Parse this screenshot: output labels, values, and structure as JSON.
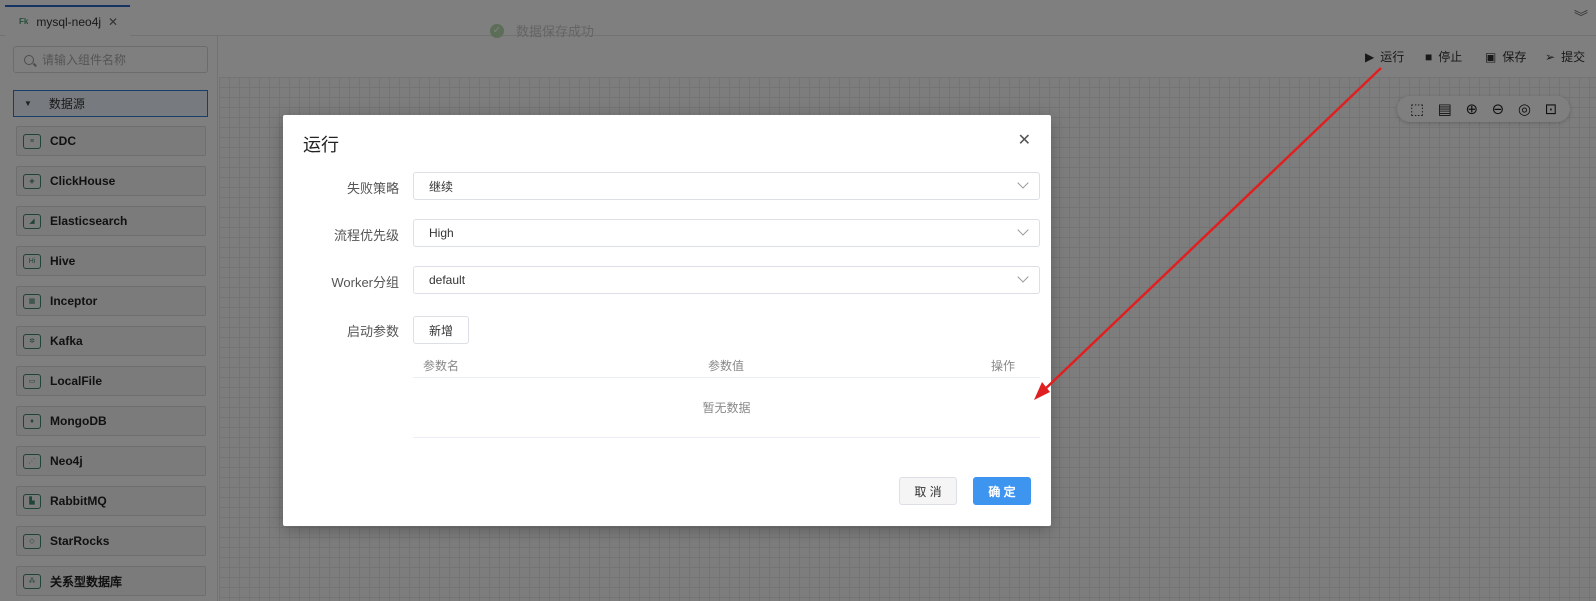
{
  "tab": {
    "title": "mysql-neo4j",
    "icon_label": "Fk"
  },
  "toast": {
    "message": "数据保存成功"
  },
  "sidebar": {
    "search_placeholder": "请输入组件名称",
    "group_label": "数据源",
    "items": [
      {
        "label": "CDC",
        "icon": "cdc-icon"
      },
      {
        "label": "ClickHouse",
        "icon": "clickhouse-icon"
      },
      {
        "label": "Elasticsearch",
        "icon": "elasticsearch-icon"
      },
      {
        "label": "Hive",
        "icon": "hive-icon",
        "glyph": "Hi"
      },
      {
        "label": "Inceptor",
        "icon": "inceptor-icon"
      },
      {
        "label": "Kafka",
        "icon": "kafka-icon"
      },
      {
        "label": "LocalFile",
        "icon": "folder-icon"
      },
      {
        "label": "MongoDB",
        "icon": "mongodb-icon"
      },
      {
        "label": "Neo4j",
        "icon": "neo4j-icon"
      },
      {
        "label": "RabbitMQ",
        "icon": "rabbitmq-icon"
      },
      {
        "label": "StarRocks",
        "icon": "starrocks-icon"
      },
      {
        "label": "关系型数据库",
        "icon": "database-icon"
      }
    ]
  },
  "toolbar": {
    "run": "运行",
    "stop": "停止",
    "save": "保存",
    "submit": "提交"
  },
  "dialog": {
    "title": "运行",
    "fields": {
      "failure_strategy": {
        "label": "失败策略",
        "value": "继续"
      },
      "priority": {
        "label": "流程优先级",
        "value": "High"
      },
      "worker_group": {
        "label": "Worker分组",
        "value": "default"
      },
      "startup_params": {
        "label": "启动参数",
        "add_button": "新增"
      }
    },
    "table": {
      "col_name": "参数名",
      "col_value": "参数值",
      "col_action": "操作",
      "empty": "暂无数据"
    },
    "cancel": "取 消",
    "confirm": "确 定"
  },
  "colors": {
    "primary": "#3d95f0",
    "accent_tab": "#2d67c9",
    "annotation_arrow": "#e02020"
  }
}
